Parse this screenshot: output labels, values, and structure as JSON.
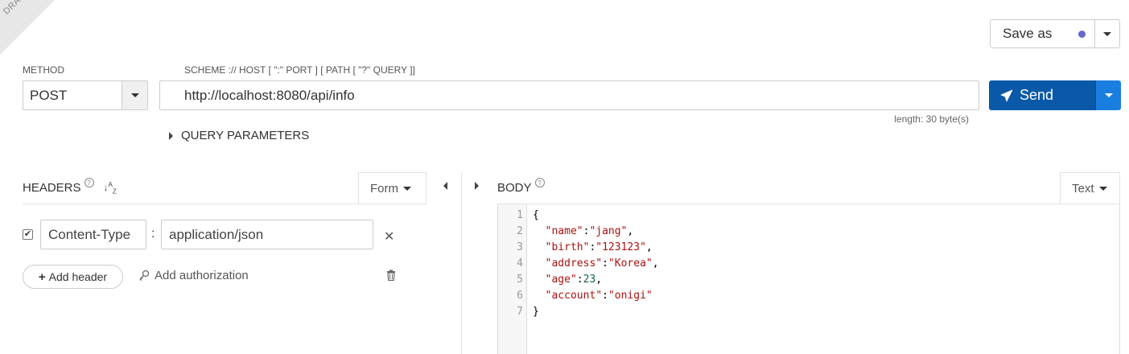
{
  "draft_label": "DRAFT",
  "save_as": {
    "label": "Save as"
  },
  "method": {
    "label": "METHOD",
    "value": "POST"
  },
  "url": {
    "label": "SCHEME :// HOST [ \":\" PORT ] [ PATH [ \"?\" QUERY ]]",
    "value": "http://localhost:8080/api/info",
    "length": "length: 30 byte(s)"
  },
  "send": {
    "label": "Send"
  },
  "query_params": {
    "label": "QUERY PARAMETERS"
  },
  "headers": {
    "title": "HEADERS",
    "mode": "Form",
    "rows": [
      {
        "enabled": true,
        "name": "Content-Type",
        "separator": ":",
        "value": "application/json"
      }
    ],
    "add_header": "Add header",
    "add_authorization": "Add authorization"
  },
  "body": {
    "title": "BODY",
    "mode": "Text",
    "lines": [
      {
        "num": "1",
        "tokens": [
          {
            "t": "{",
            "c": "p"
          }
        ]
      },
      {
        "num": "2",
        "tokens": [
          {
            "t": "  ",
            "c": "p"
          },
          {
            "t": "\"name\"",
            "c": "key"
          },
          {
            "t": ":",
            "c": "p"
          },
          {
            "t": "\"jang\"",
            "c": "str"
          },
          {
            "t": ",",
            "c": "p"
          }
        ]
      },
      {
        "num": "3",
        "tokens": [
          {
            "t": "  ",
            "c": "p"
          },
          {
            "t": "\"birth\"",
            "c": "key"
          },
          {
            "t": ":",
            "c": "p"
          },
          {
            "t": "\"123123\"",
            "c": "str"
          },
          {
            "t": ",",
            "c": "p"
          }
        ]
      },
      {
        "num": "4",
        "tokens": [
          {
            "t": "  ",
            "c": "p"
          },
          {
            "t": "\"address\"",
            "c": "key"
          },
          {
            "t": ":",
            "c": "p"
          },
          {
            "t": "\"Korea\"",
            "c": "str"
          },
          {
            "t": ",",
            "c": "p"
          }
        ]
      },
      {
        "num": "5",
        "tokens": [
          {
            "t": "  ",
            "c": "p"
          },
          {
            "t": "\"age\"",
            "c": "key"
          },
          {
            "t": ":",
            "c": "p"
          },
          {
            "t": "23",
            "c": "num"
          },
          {
            "t": ",",
            "c": "p"
          }
        ]
      },
      {
        "num": "6",
        "tokens": [
          {
            "t": "  ",
            "c": "p"
          },
          {
            "t": "\"account\"",
            "c": "key"
          },
          {
            "t": ":",
            "c": "p"
          },
          {
            "t": "\"onigi\"",
            "c": "str"
          }
        ]
      },
      {
        "num": "7",
        "tokens": [
          {
            "t": "}",
            "c": "p"
          }
        ]
      }
    ]
  },
  "colors": {
    "send_primary": "#0a59a8",
    "send_dropdown": "#1a7ee0",
    "save_dot": "#6666cc",
    "json_string": "#aa1111",
    "json_number": "#116644"
  }
}
